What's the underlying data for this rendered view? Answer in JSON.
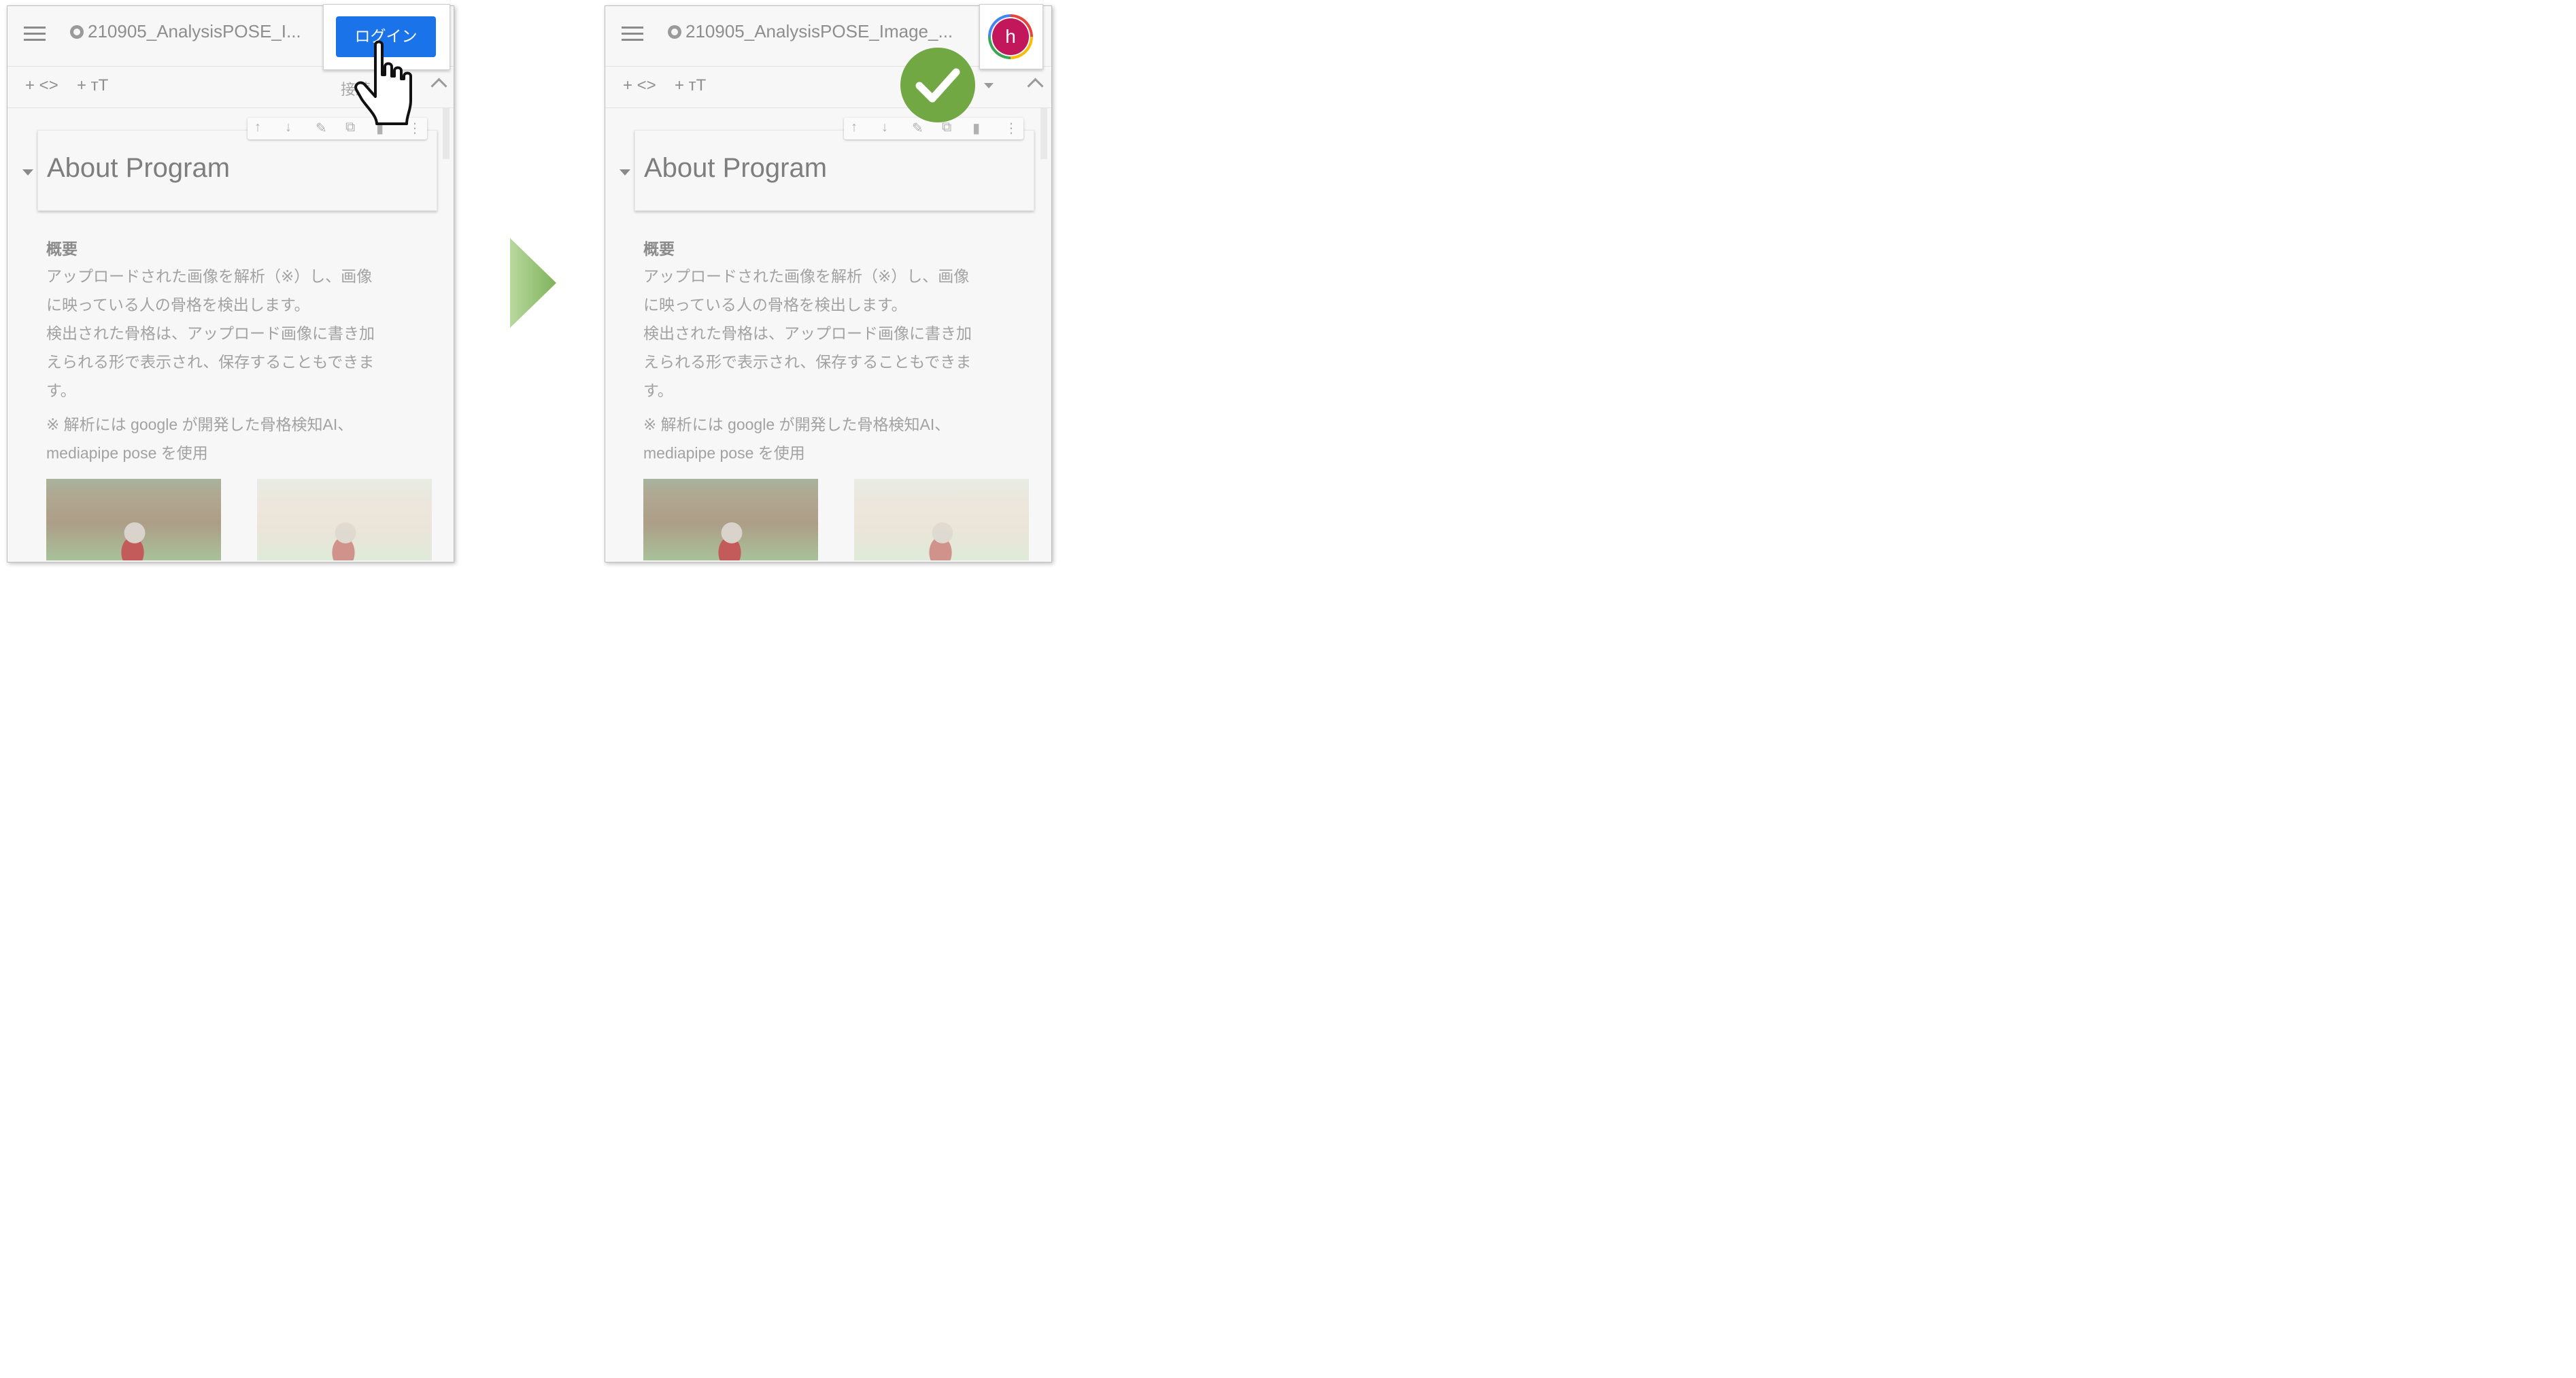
{
  "colab": {
    "repo_title_before": "210905_AnalysisPOSE_I...",
    "repo_title_after": "210905_AnalysisPOSE_Image_...",
    "add_code": "+ <>",
    "add_text": "+ тT",
    "connect": "接続",
    "cell_heading": "About Program",
    "section_title": "概要",
    "paragraph_lines": [
      "アップロードされた画像を解析（※）し、画像",
      "に映っている人の骨格を検出します。",
      "検出された骨格は、アップロード画像に書き加",
      "えられる形で表示され、保存することもできま",
      "す。"
    ],
    "note_lines": [
      "※ 解析には google が開発した骨格検知AI、",
      "mediapipe pose を使用"
    ]
  },
  "login": {
    "button_label": "ログイン"
  },
  "account": {
    "avatar_letter": "h"
  },
  "icons": {
    "menu": "hamburger-icon",
    "github": "github-icon",
    "pointer": "hand-pointer-icon",
    "next": "arrow-right-icon",
    "success": "checkmark-icon"
  },
  "colors": {
    "login_blue": "#1a73e8",
    "check_green": "#72a844",
    "avatar_magenta": "#c2185b",
    "arrow_green": "#8fbf6a"
  }
}
